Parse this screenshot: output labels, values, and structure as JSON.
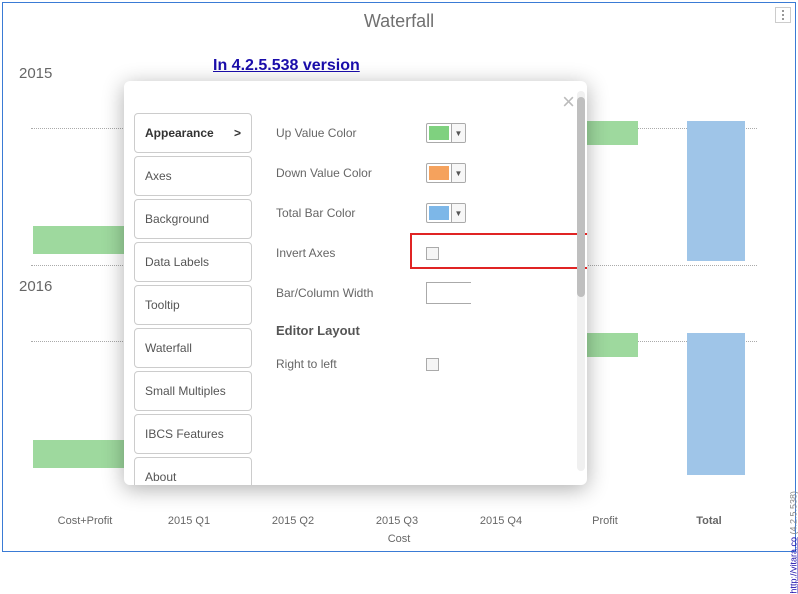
{
  "header": {
    "title": "Waterfall",
    "version_link": "In 4.2.5.538 version",
    "vitara_link_text": "http://vitara.co",
    "vitara_version": " (4.2.5.538)"
  },
  "yaxis": {
    "y2015": "2015",
    "y2016": "2016"
  },
  "xaxis": {
    "items": [
      "Cost+Profit",
      "2015 Q1",
      "2015 Q2",
      "2015 Q3",
      "2015 Q4",
      "Profit",
      "Total"
    ],
    "label": "Cost"
  },
  "sidebar": {
    "items": [
      {
        "label": "Appearance",
        "active": true
      },
      {
        "label": "Axes"
      },
      {
        "label": "Background"
      },
      {
        "label": "Data Labels"
      },
      {
        "label": "Tooltip"
      },
      {
        "label": "Waterfall"
      },
      {
        "label": "Small Multiples"
      },
      {
        "label": "IBCS Features"
      },
      {
        "label": "About"
      }
    ]
  },
  "panel": {
    "up_value_label": "Up Value Color",
    "down_value_label": "Down Value Color",
    "total_bar_label": "Total Bar Color",
    "invert_axes_label": "Invert Axes",
    "bar_width_label": "Bar/Column Width",
    "section_layout": "Editor Layout",
    "rtl_label": "Right to left",
    "colors": {
      "up": "#7fd17f",
      "down": "#f5a25d",
      "total": "#7db7e8"
    }
  },
  "chart_data": {
    "type": "bar",
    "title": "Waterfall",
    "categories": [
      "Cost+Profit",
      "2015 Q1",
      "2015 Q2",
      "2015 Q3",
      "2015 Q4",
      "Profit",
      "Total"
    ],
    "groups": [
      "2015",
      "2016"
    ],
    "xlabel": "Cost",
    "note": "Horizontal waterfall bars; underlying numeric values not labeled on chart so only category + color semantics captured.",
    "series_colors": {
      "up": "#9ed99e",
      "down": "#f5a25d",
      "total": "#9fc5e8"
    }
  }
}
